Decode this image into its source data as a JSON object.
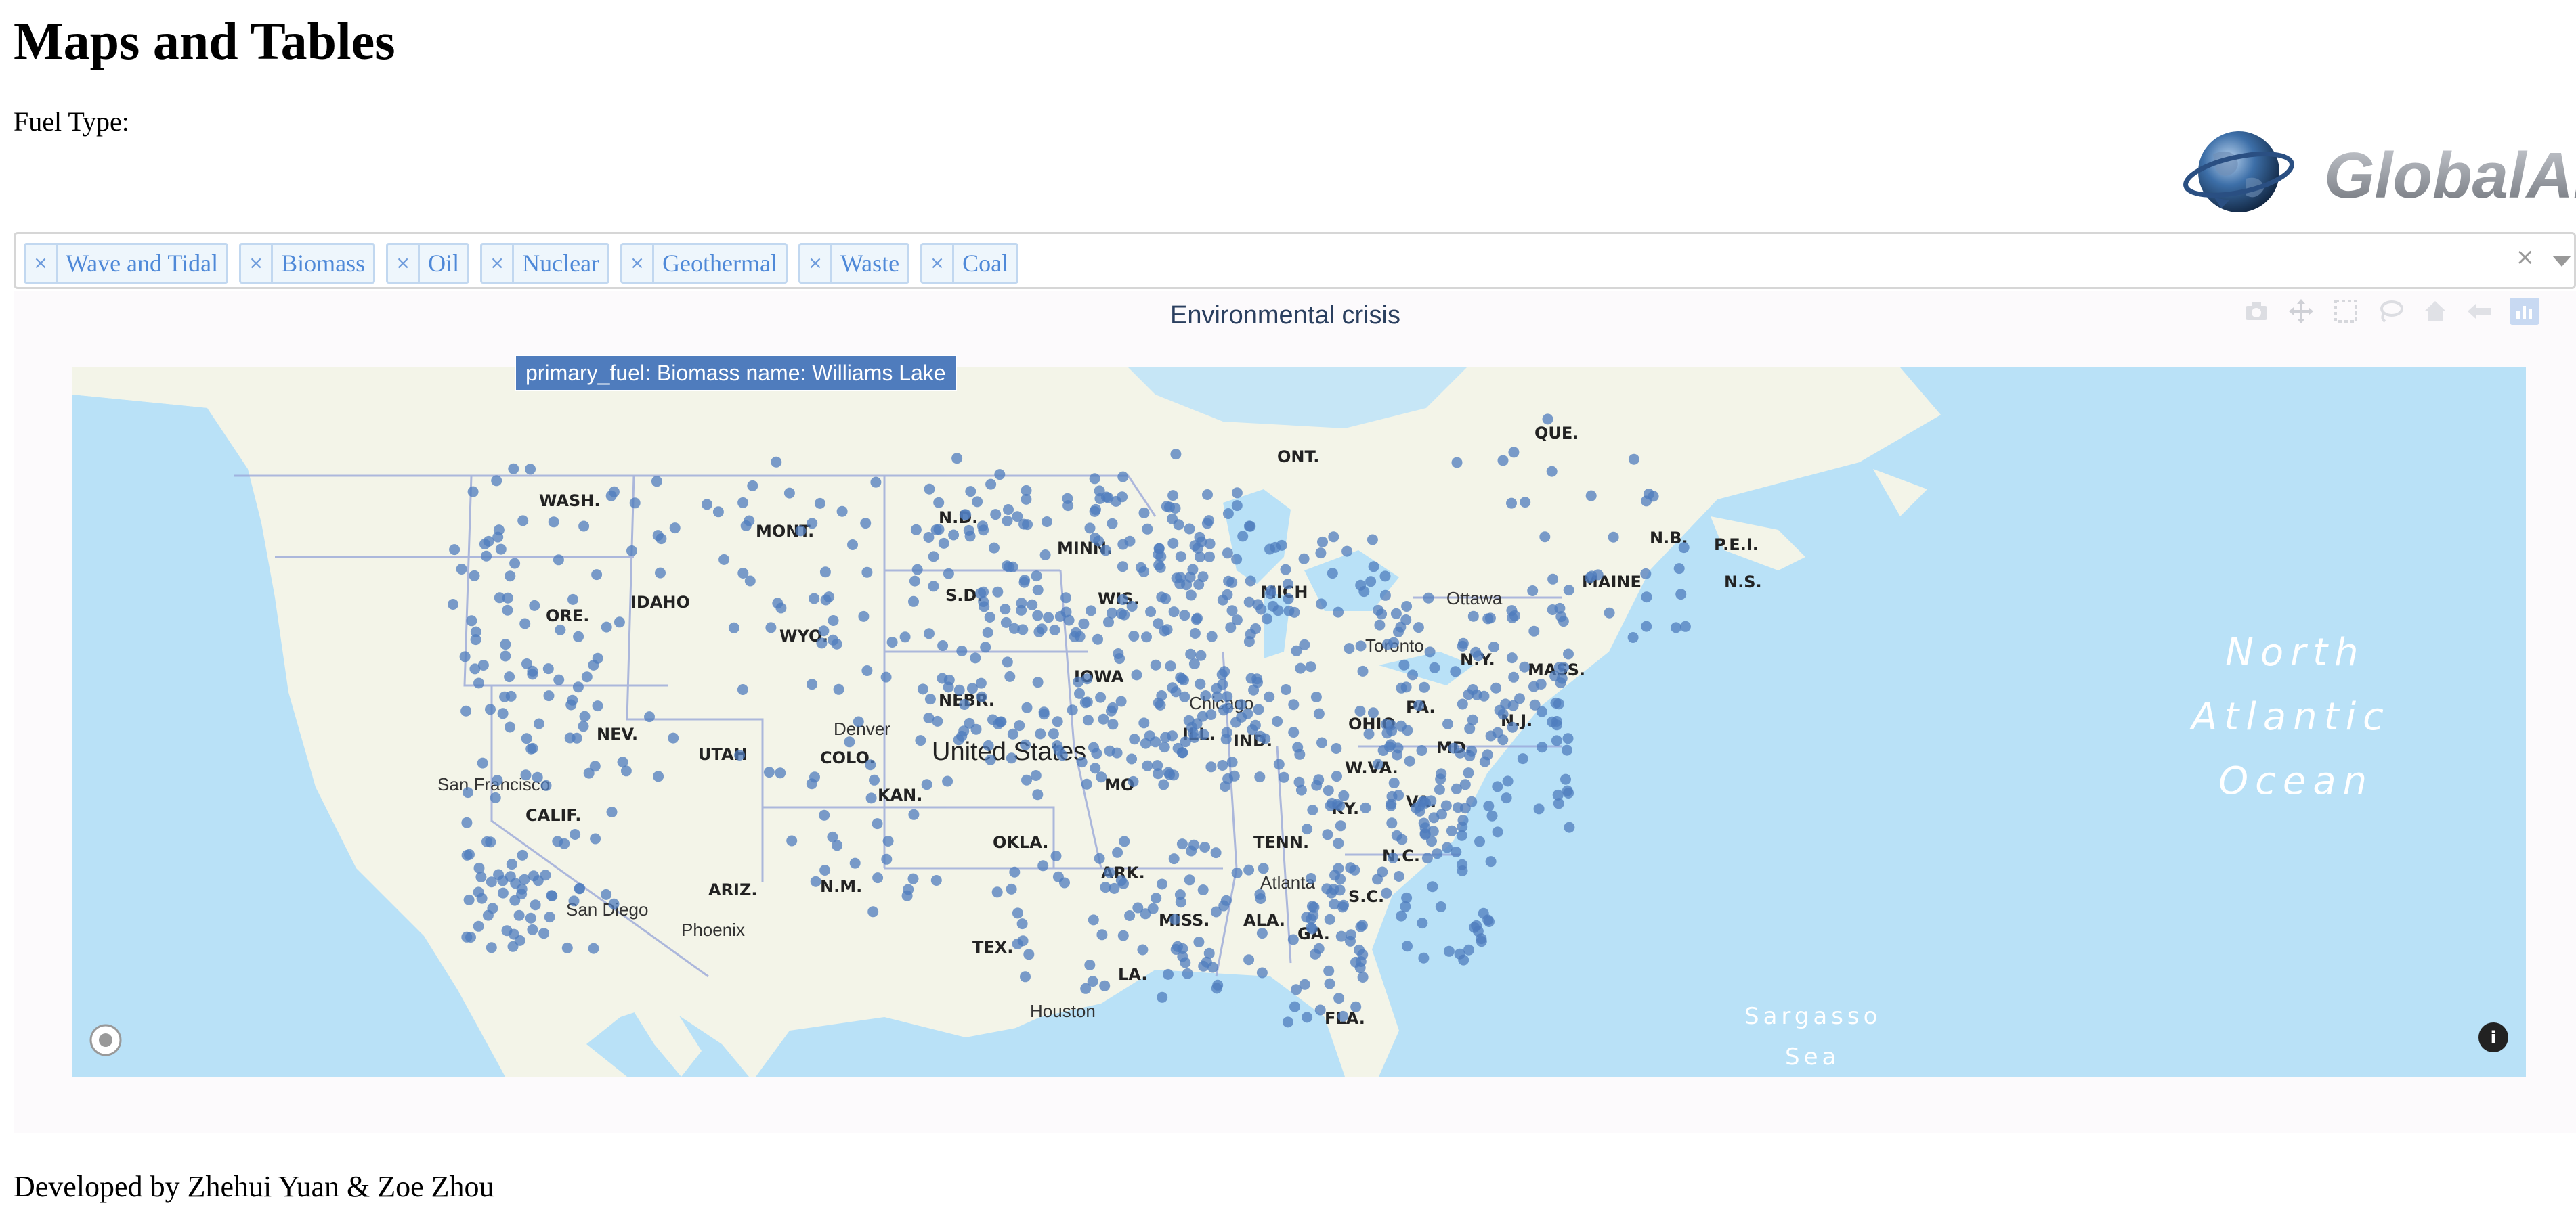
{
  "page": {
    "title": "Maps and Tables"
  },
  "filter": {
    "label": "Fuel Type:",
    "selected": [
      "Wave and Tidal",
      "Biomass",
      "Oil",
      "Nuclear",
      "Geothermal",
      "Waste",
      "Coal"
    ],
    "remove_glyph": "×",
    "clear_glyph": "×"
  },
  "logo": {
    "text": "GlobalAi"
  },
  "chart": {
    "title": "Environmental crisis",
    "hover": "primary_fuel: Biomass   name: Williams Lake",
    "modebar": [
      "camera-icon",
      "pan-icon",
      "box-select-icon",
      "lasso-icon",
      "home-icon",
      "reset-view-icon",
      "plotly-logo-icon"
    ],
    "marker_color": "#4f7cbd",
    "map_labels": {
      "states": [
        "WASH.",
        "MONT.",
        "N.D.",
        "MINN.",
        "ORE.",
        "IDAHO",
        "WYO.",
        "S.D.",
        "WIS.",
        "MICH",
        "NEBR.",
        "IOWA",
        "NEV.",
        "UTAH",
        "COLO.",
        "ILL.",
        "IND.",
        "OHIO",
        "PA.",
        "N.Y.",
        "CALIF.",
        "KY.",
        "W.VA.",
        "VA.",
        "MO",
        "KAN.",
        "OKLA.",
        "ARK.",
        "TENN.",
        "N.C.",
        "S.C.",
        "ARIZ.",
        "N.M.",
        "TEX.",
        "MISS.",
        "ALA.",
        "GA.",
        "LA.",
        "FLA.",
        "MAINE",
        "ONT.",
        "QUE.",
        "N.B.",
        "P.E.I.",
        "N.S.",
        "MASS.",
        "N.J.",
        "MD."
      ],
      "cities": [
        "San Francisco",
        "San Diego",
        "Phoenix",
        "Denver",
        "Chicago",
        "Toronto",
        "Ottawa",
        "Atlanta",
        "Houston"
      ],
      "country": "United States",
      "ocean": [
        "North",
        "Atlantic",
        "Ocean"
      ],
      "sea": [
        "Sargasso",
        "Sea"
      ]
    }
  },
  "footer": {
    "text": "Developed by Zhehui Yuan & Zoe Zhou"
  }
}
